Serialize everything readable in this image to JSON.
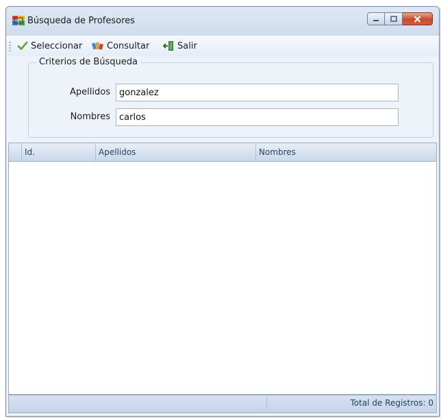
{
  "window": {
    "title": "Búsqueda de Profesores"
  },
  "toolbar": {
    "seleccionar_label": "Seleccionar",
    "consultar_label": "Consultar",
    "salir_label": "Salir"
  },
  "criteria": {
    "legend": "Criterios de Búsqueda",
    "apellidos_label": "Apellidos",
    "apellidos_value": "gonzalez",
    "nombres_label": "Nombres",
    "nombres_value": "carlos"
  },
  "grid": {
    "columns": [
      "Id.",
      "Apellidos",
      "Nombres"
    ],
    "rows": []
  },
  "status": {
    "total_text": "Total de Registros: 0"
  },
  "colors": {
    "accent": "#5cae2f",
    "header_text": "#27435f",
    "window_bg": "#eef3fa"
  },
  "icons": {
    "app": "app-grid-icon",
    "seleccionar": "checkmark-icon",
    "consultar": "search-books-icon",
    "salir": "exit-door-icon"
  }
}
